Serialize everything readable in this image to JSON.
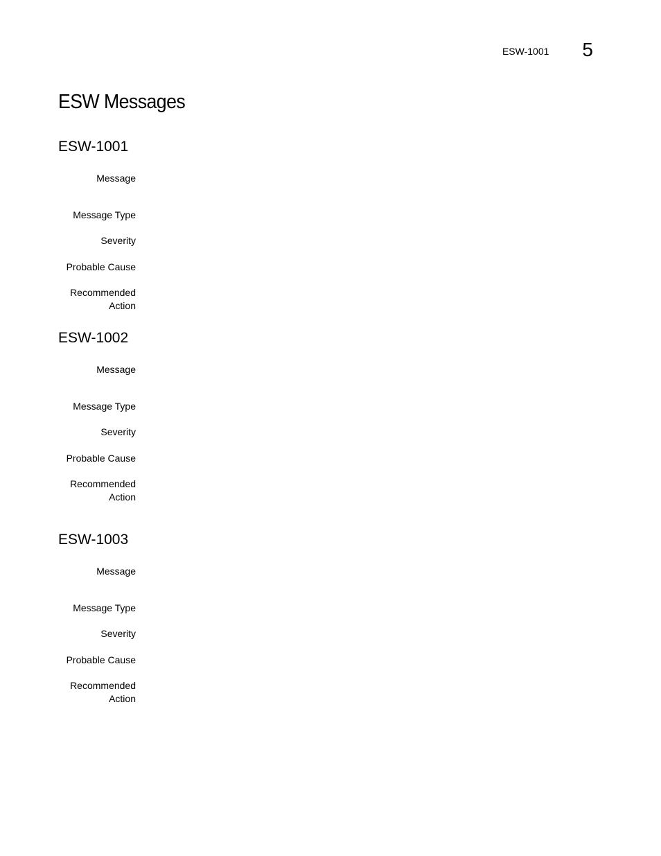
{
  "header": {
    "running_title": "ESW-1001",
    "chapter_number": "5"
  },
  "page": {
    "title": "ESW Messages"
  },
  "sections": [
    {
      "id": "ESW-1001",
      "fields": [
        {
          "label": "Message",
          "value": ""
        },
        {
          "label": "Message Type",
          "value": ""
        },
        {
          "label": "Severity",
          "value": ""
        },
        {
          "label": "Probable Cause",
          "value": ""
        },
        {
          "label": "Recommended\nAction",
          "value": ""
        }
      ]
    },
    {
      "id": "ESW-1002",
      "fields": [
        {
          "label": "Message",
          "value": ""
        },
        {
          "label": "Message Type",
          "value": ""
        },
        {
          "label": "Severity",
          "value": ""
        },
        {
          "label": "Probable Cause",
          "value": ""
        },
        {
          "label": "Recommended\nAction",
          "value": ""
        }
      ]
    },
    {
      "id": "ESW-1003",
      "fields": [
        {
          "label": "Message",
          "value": ""
        },
        {
          "label": "Message Type",
          "value": ""
        },
        {
          "label": "Severity",
          "value": ""
        },
        {
          "label": "Probable Cause",
          "value": ""
        },
        {
          "label": "Recommended\nAction",
          "value": ""
        }
      ]
    }
  ]
}
